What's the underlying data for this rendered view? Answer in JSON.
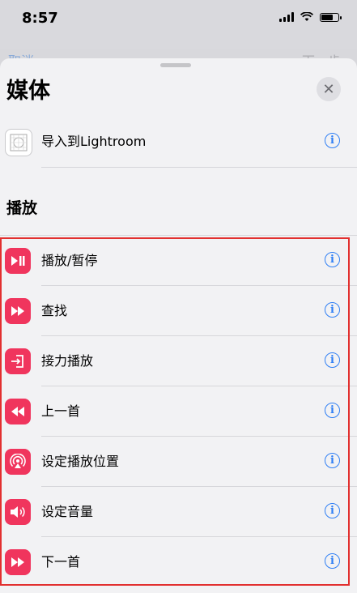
{
  "status_bar": {
    "time": "8:57"
  },
  "background": {
    "left_label": "取消",
    "right_label": "下一步"
  },
  "sheet": {
    "title": "媒体",
    "close_glyph": "✕",
    "top_item": {
      "label": "导入到Lightroom",
      "icon": "lightroom-icon"
    },
    "section_title": "播放",
    "items": [
      {
        "label": "播放/暂停",
        "icon": "play-pause-icon"
      },
      {
        "label": "查找",
        "icon": "fast-forward-icon"
      },
      {
        "label": "接力播放",
        "icon": "handoff-icon"
      },
      {
        "label": "上一首",
        "icon": "rewind-icon"
      },
      {
        "label": "设定播放位置",
        "icon": "airplay-icon"
      },
      {
        "label": "设定音量",
        "icon": "volume-icon"
      },
      {
        "label": "下一首",
        "icon": "next-track-icon"
      }
    ],
    "info_glyph": "i"
  },
  "colors": {
    "accent": "#2f7ff5",
    "action_pink": "#f0355d",
    "highlight_box": "#e2302f"
  }
}
